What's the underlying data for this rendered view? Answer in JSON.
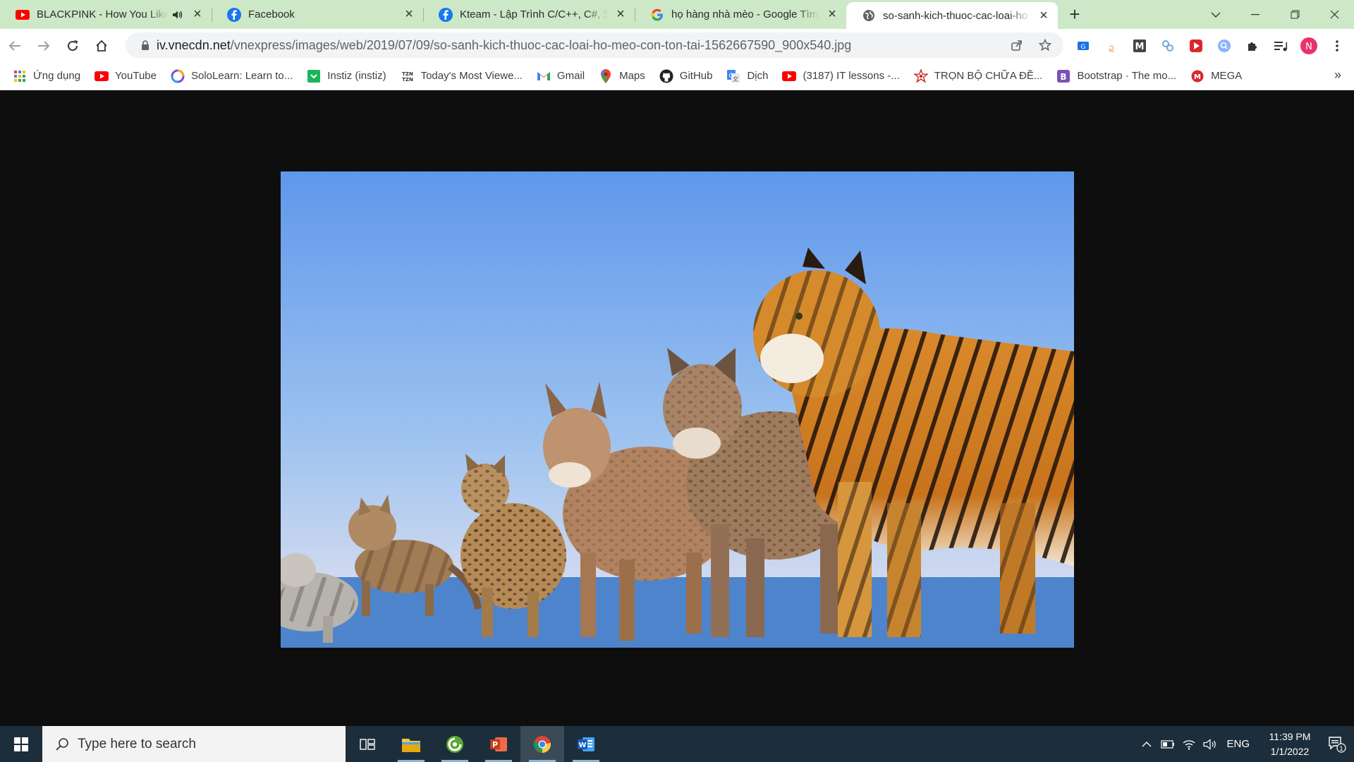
{
  "browser": {
    "tabs": [
      {
        "title": "BLACKPINK - How You Like That",
        "favicon": "youtube-icon",
        "audio": true,
        "active": false
      },
      {
        "title": "Facebook",
        "favicon": "facebook-icon",
        "audio": false,
        "active": false
      },
      {
        "title": "Kteam - Lập Trình C/C++, C#, SQL",
        "favicon": "facebook-icon",
        "audio": false,
        "active": false
      },
      {
        "title": "họ hàng nhà mèo - Google Tìm kiếm",
        "favicon": "google-icon",
        "audio": false,
        "active": false
      },
      {
        "title": "so-sanh-kich-thuoc-cac-loai-ho-meo",
        "favicon": "globe-icon",
        "audio": false,
        "active": true
      }
    ],
    "url_host": "iv.vnecdn.net",
    "url_path": "/vnexpress/images/web/2019/07/09/so-sanh-kich-thuoc-cac-loai-ho-meo-con-ton-tai-1562667590_900x540.jpg",
    "profile_initial": "N",
    "bookmarks": [
      {
        "label": "Ứng dụng",
        "icon": "apps-grid-icon"
      },
      {
        "label": "YouTube",
        "icon": "youtube-icon"
      },
      {
        "label": "SoloLearn: Learn to...",
        "icon": "sololearn-icon"
      },
      {
        "label": "Instiz (instiz)",
        "icon": "instiz-icon"
      },
      {
        "label": "Today's Most Viewe...",
        "icon": "tzn-icon"
      },
      {
        "label": "Gmail",
        "icon": "gmail-icon"
      },
      {
        "label": "Maps",
        "icon": "maps-icon"
      },
      {
        "label": "GitHub",
        "icon": "github-icon"
      },
      {
        "label": "Dịch",
        "icon": "translate-icon"
      },
      {
        "label": "(3187) IT lessons -...",
        "icon": "youtube-icon"
      },
      {
        "label": "TRỌN BỘ CHỮA ĐỀ...",
        "icon": "star-logo-icon"
      },
      {
        "label": "Bootstrap · The mo...",
        "icon": "bootstrap-icon"
      },
      {
        "label": "MEGA",
        "icon": "mega-icon"
      }
    ]
  },
  "taskbar": {
    "search_placeholder": "Type here to search",
    "apps": [
      "task-view-icon",
      "file-explorer-icon",
      "camtasia-icon",
      "powerpoint-icon",
      "chrome-icon",
      "word-icon"
    ],
    "language": "ENG",
    "time": "11:39 PM",
    "date": "1/1/2022",
    "notification_count": "1"
  },
  "colors": {
    "tabstrip": "#cde8c6",
    "sky_top": "#5f97ec",
    "sky_bottom": "#e8e4f0",
    "ground": "#4e84cc",
    "taskbar": "#1c2e3b"
  }
}
